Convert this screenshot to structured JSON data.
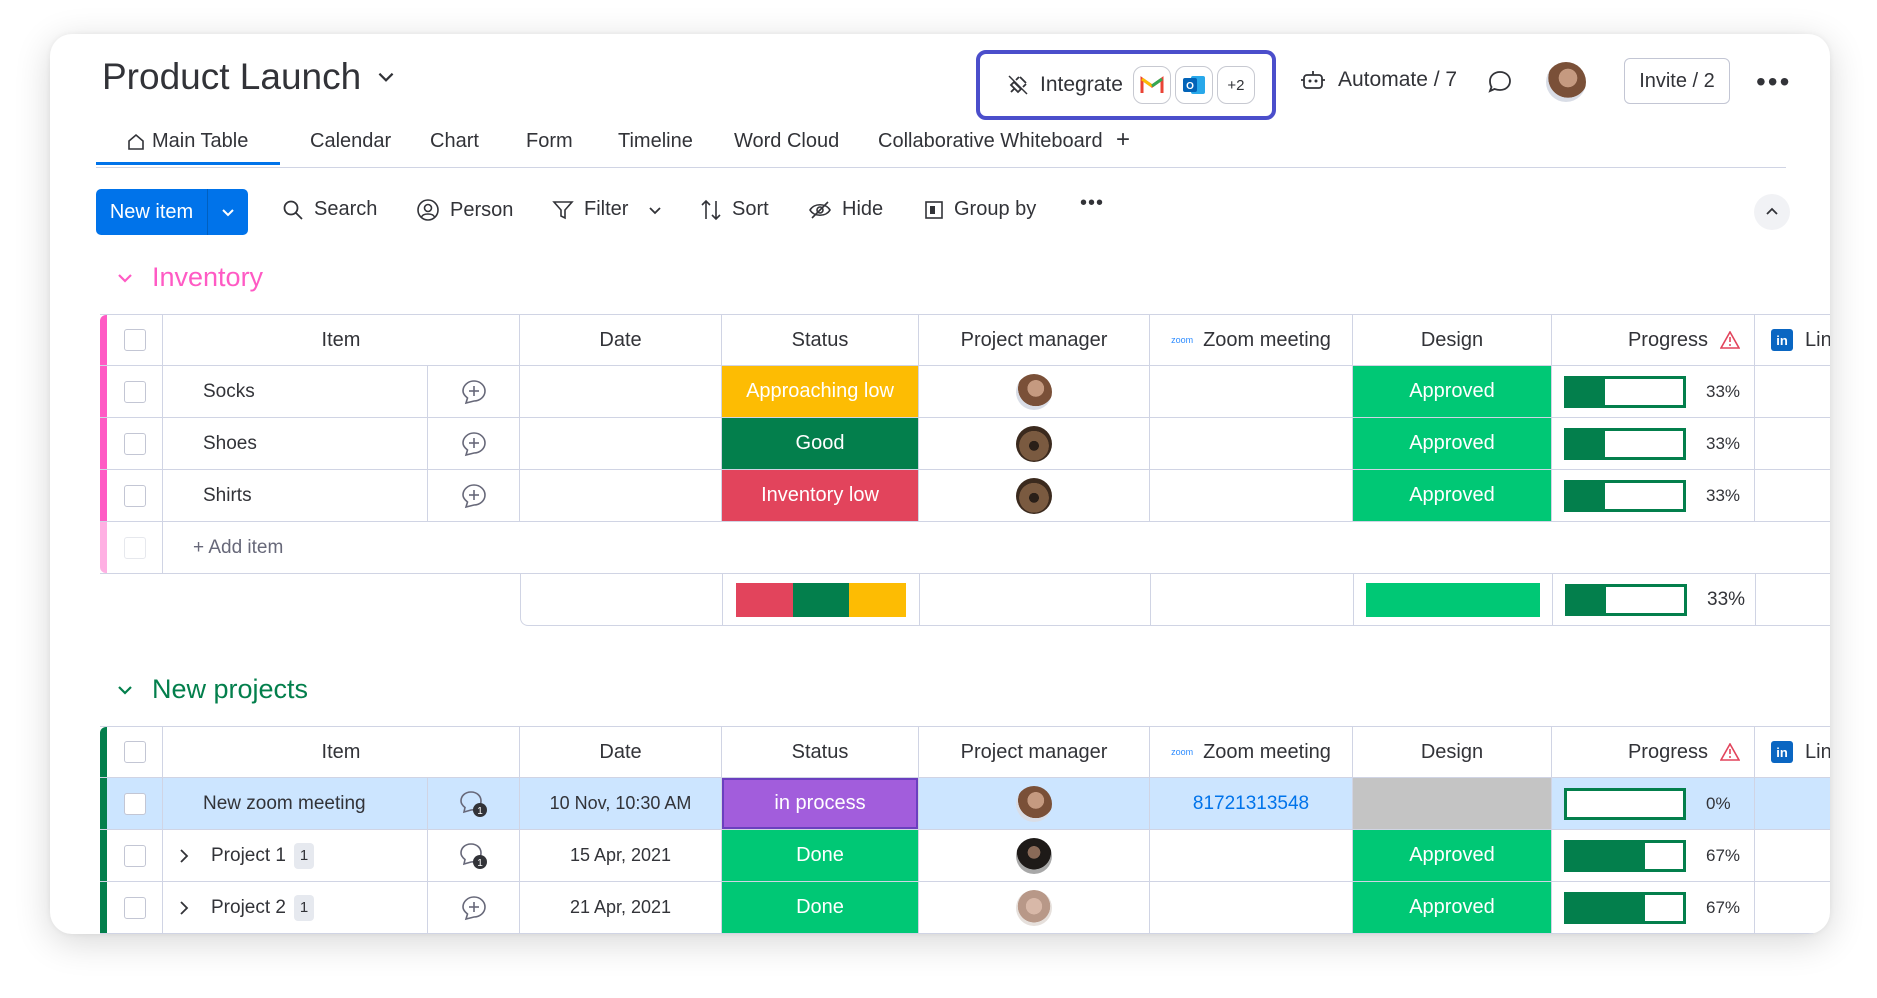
{
  "board": {
    "title": "Product Launch"
  },
  "header": {
    "integrate_label": "Integrate",
    "integrate_more": "+2",
    "automate_label": "Automate / 7",
    "invite_label": "Invite / 2"
  },
  "tabs": [
    "Main Table",
    "Calendar",
    "Chart",
    "Form",
    "Timeline",
    "Word Cloud",
    "Collaborative Whiteboard",
    "+"
  ],
  "toolbar": {
    "new_item": "New item",
    "search": "Search",
    "person": "Person",
    "filter": "Filter",
    "sort": "Sort",
    "hide": "Hide",
    "group_by": "Group by"
  },
  "columns": {
    "item": "Item",
    "date": "Date",
    "status": "Status",
    "pm": "Project manager",
    "zoom": "Zoom meeting",
    "zoom_logo": "zoom",
    "design": "Design",
    "progress": "Progress",
    "linkedin": "Lin"
  },
  "groups": [
    {
      "name": "Inventory",
      "color": "#ff5ac4",
      "add_item": "+ Add item",
      "rows": [
        {
          "item": "Socks",
          "status": "Approaching low",
          "status_color": "#fdbc03",
          "design": "Approved",
          "progress_pct": 33,
          "progress_label": "33%"
        },
        {
          "item": "Shoes",
          "status": "Good",
          "status_color": "#037f4c",
          "design": "Approved",
          "progress_pct": 33,
          "progress_label": "33%"
        },
        {
          "item": "Shirts",
          "status": "Inventory low",
          "status_color": "#e2445c",
          "design": "Approved",
          "progress_pct": 33,
          "progress_label": "33%"
        }
      ],
      "summary": {
        "progress_pct": 33,
        "progress_label": "33%"
      }
    },
    {
      "name": "New projects",
      "color": "#037f4c",
      "rows": [
        {
          "item": "New zoom meeting",
          "date": "10 Nov, 10:30 AM",
          "status": "in process",
          "status_color": "#a25ddc",
          "zoom": "81721313548",
          "design": "",
          "progress_pct": 0,
          "progress_label": "0%"
        },
        {
          "item": "Project 1",
          "subitems": "1",
          "date": "15 Apr, 2021",
          "status": "Done",
          "status_color": "#00c875",
          "design": "Approved",
          "progress_pct": 67,
          "progress_label": "67%"
        },
        {
          "item": "Project 2",
          "subitems": "1",
          "date": "21 Apr, 2021",
          "status": "Done",
          "status_color": "#00c875",
          "design": "Approved",
          "progress_pct": 67,
          "progress_label": "67%"
        }
      ]
    }
  ],
  "colors": {
    "accent": "#0073ea",
    "approved": "#00c875",
    "highlight": "#4b4ecb",
    "selected_row": "#cce5ff"
  }
}
